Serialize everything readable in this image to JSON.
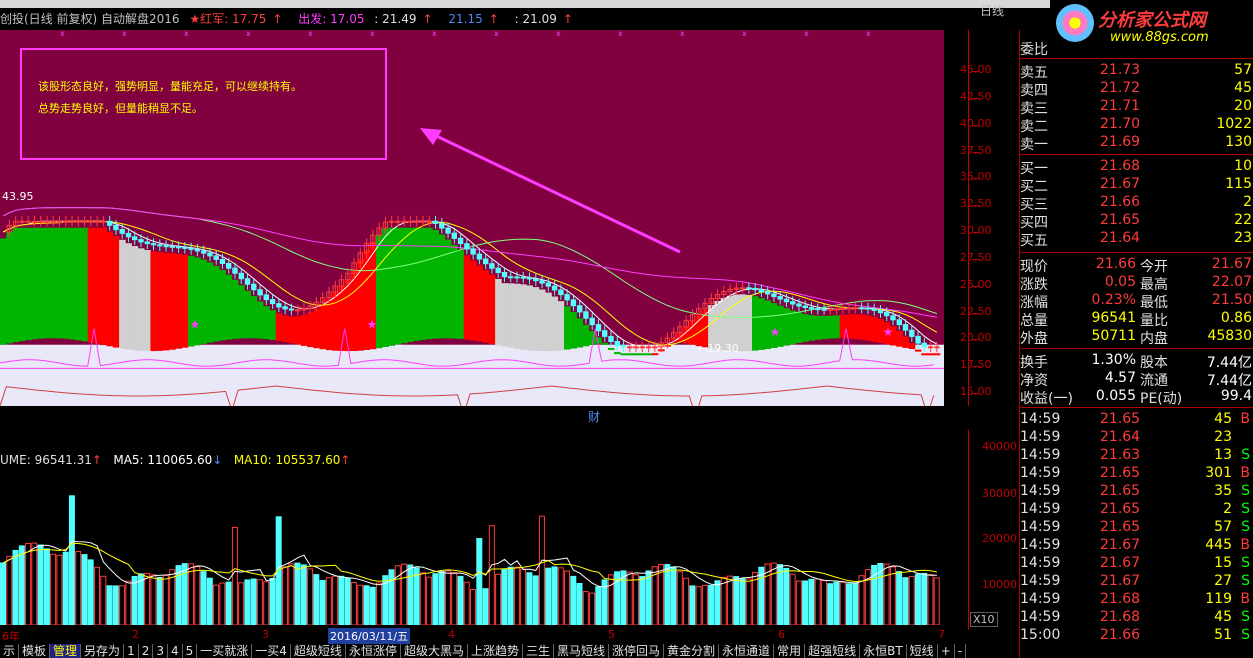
{
  "title_bar": {
    "stock": "创投(日线 前复权) 自动解盘2016",
    "red_army_label": "★红军: 17.75",
    "red_army_arrow": "↑",
    "start_label": "出发: 17.05",
    "value1": ": 21.49",
    "value1_arrow": "↑",
    "value2": "21.15",
    "value2_arrow": "↑",
    "value3": ": 21.09",
    "value3_arrow": "↑"
  },
  "annotation": {
    "line1": "该股形态良好，强势明显，量能充足，可以继续持有。",
    "line2": "总势走势良好，但量能稍显不足。"
  },
  "main_chart": {
    "high_label": "43.95",
    "low_label": "←19.30",
    "price_ticks": [
      "45.00",
      "42.50",
      "40.00",
      "37.50",
      "35.00",
      "32.50",
      "30.00",
      "27.50",
      "25.00",
      "22.50",
      "20.00",
      "17.50",
      "15.00"
    ],
    "cai_label": "财",
    "colors": {
      "bg": "#800040",
      "red": "#ff0000",
      "green": "#00b400",
      "gray": "#d0d0d0",
      "lavender": "#e8e8f8",
      "magenta": "#ff3cff"
    }
  },
  "volume": {
    "ume_label": "UME: 96541.31",
    "ume_arrow": "↑",
    "ma5_label": "MA5: 110065.60",
    "ma5_arrow": "↓",
    "ma10_label": "MA10: 105537.60",
    "ma10_arrow": "↑",
    "ticks": [
      "40000",
      "30000",
      "20000",
      "10000"
    ],
    "multiplier": "X10",
    "colors": {
      "up": "#ff3c3c",
      "down": "#54ffff",
      "ma5": "#ffffff",
      "ma10": "#ffff00"
    }
  },
  "date_axis": {
    "labels": [
      "6年",
      "2",
      "3",
      "2016/03/11/五",
      "4",
      "5",
      "6",
      "7"
    ],
    "right_label": "日线"
  },
  "bottom_tabs": [
    {
      "label": "示"
    },
    {
      "label": "模板"
    },
    {
      "label": "管理",
      "active": true
    },
    {
      "label": "另存为"
    },
    {
      "label": "1"
    },
    {
      "label": "2"
    },
    {
      "label": "3"
    },
    {
      "label": "4"
    },
    {
      "label": "5"
    },
    {
      "label": "一买就涨"
    },
    {
      "label": "一买4"
    },
    {
      "label": "超级短线"
    },
    {
      "label": "永恒涨停"
    },
    {
      "label": "超级大黑马"
    },
    {
      "label": "上涨趋势"
    },
    {
      "label": "三生"
    },
    {
      "label": "黑马短线"
    },
    {
      "label": "涨停回马"
    },
    {
      "label": "黄金分割"
    },
    {
      "label": "永恒通道"
    },
    {
      "label": "常用"
    },
    {
      "label": "超强短线"
    },
    {
      "label": "永恒BT"
    },
    {
      "label": "短线"
    },
    {
      "label": "+"
    },
    {
      "label": "-"
    }
  ],
  "logo": {
    "name": "分析家公式网",
    "url": "www.88gs.com"
  },
  "quote_panel": {
    "wei_bi": "委比",
    "sell": [
      {
        "label": "卖五",
        "price": "21.73",
        "vol": "57"
      },
      {
        "label": "卖四",
        "price": "21.72",
        "vol": "45"
      },
      {
        "label": "卖三",
        "price": "21.71",
        "vol": "20"
      },
      {
        "label": "卖二",
        "price": "21.70",
        "vol": "1022"
      },
      {
        "label": "卖一",
        "price": "21.69",
        "vol": "130"
      }
    ],
    "buy": [
      {
        "label": "买一",
        "price": "21.68",
        "vol": "10"
      },
      {
        "label": "买二",
        "price": "21.67",
        "vol": "115"
      },
      {
        "label": "买三",
        "price": "21.66",
        "vol": "2"
      },
      {
        "label": "买四",
        "price": "21.65",
        "vol": "22"
      },
      {
        "label": "买五",
        "price": "21.64",
        "vol": "23"
      }
    ],
    "stats": [
      {
        "l1": "现价",
        "v1": "21.66",
        "l2": "今开",
        "v2": "21.67"
      },
      {
        "l1": "涨跌",
        "v1": "0.05",
        "l2": "最高",
        "v2": "22.07"
      },
      {
        "l1": "涨幅",
        "v1": "0.23%",
        "l2": "最低",
        "v2": "21.50"
      },
      {
        "l1": "总量",
        "v1": "96541",
        "l2": "量比",
        "v2": "0.86"
      },
      {
        "l1": "外盘",
        "v1": "50711",
        "l2": "内盘",
        "v2": "45830"
      }
    ],
    "stats2": [
      {
        "l1": "换手",
        "v1": "1.30%",
        "l2": "股本",
        "v2": "7.44亿"
      },
      {
        "l1": "净资",
        "v1": "4.57",
        "l2": "流通",
        "v2": "7.44亿"
      },
      {
        "l1": "收益(一)",
        "v1": "0.055",
        "l2": "PE(动)",
        "v2": "99.4"
      }
    ],
    "trades": [
      {
        "time": "14:59",
        "price": "21.65",
        "vol": "45",
        "side": "B"
      },
      {
        "time": "14:59",
        "price": "21.64",
        "vol": "23",
        "side": ""
      },
      {
        "time": "14:59",
        "price": "21.63",
        "vol": "13",
        "side": "S"
      },
      {
        "time": "14:59",
        "price": "21.65",
        "vol": "301",
        "side": "B"
      },
      {
        "time": "14:59",
        "price": "21.65",
        "vol": "35",
        "side": "S"
      },
      {
        "time": "14:59",
        "price": "21.65",
        "vol": "2",
        "side": "S"
      },
      {
        "time": "14:59",
        "price": "21.65",
        "vol": "57",
        "side": "S"
      },
      {
        "time": "14:59",
        "price": "21.67",
        "vol": "445",
        "side": "B"
      },
      {
        "time": "14:59",
        "price": "21.67",
        "vol": "15",
        "side": "S"
      },
      {
        "time": "14:59",
        "price": "21.67",
        "vol": "27",
        "side": "S"
      },
      {
        "time": "14:59",
        "price": "21.68",
        "vol": "119",
        "side": "B"
      },
      {
        "time": "14:59",
        "price": "21.68",
        "vol": "45",
        "side": "S"
      },
      {
        "time": "15:00",
        "price": "21.66",
        "vol": "51",
        "side": "S"
      }
    ]
  }
}
